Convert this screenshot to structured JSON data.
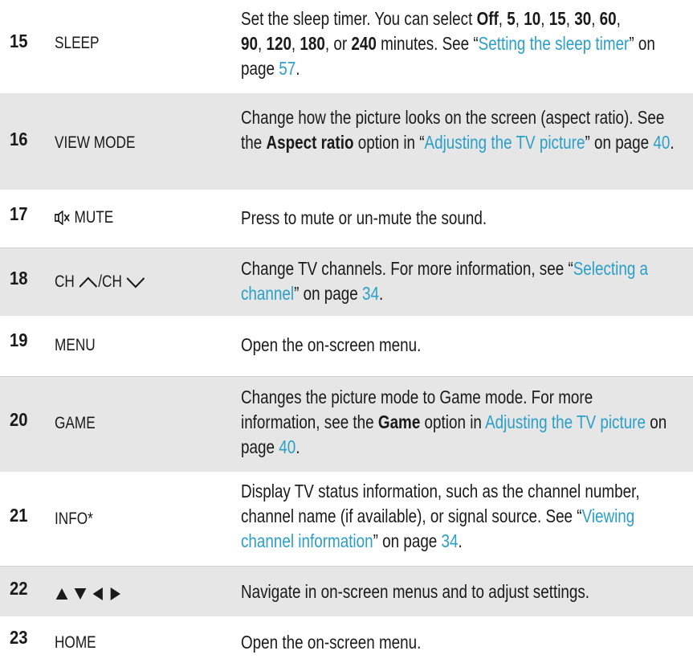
{
  "rows": [
    {
      "num": "15",
      "key": "SLEEP",
      "d": [
        "Set the sleep timer. You can select ",
        "Off",
        ", ",
        "5",
        ", ",
        "10",
        ", ",
        "15",
        ", ",
        "30",
        ", ",
        "60",
        ",",
        "90",
        ", ",
        "120",
        ", ",
        "180",
        ", or ",
        "240",
        " minutes. See “",
        "Setting the sleep timer",
        "” on page ",
        "57",
        "."
      ]
    },
    {
      "num": "16",
      "key": "VIEW MODE",
      "d": [
        "Change how the picture looks on the screen (aspect ratio). See the ",
        "Aspect ratio",
        " option in “",
        "Adjusting the TV picture",
        "” on page ",
        "40",
        "."
      ]
    },
    {
      "num": "17",
      "key": "MUTE",
      "d": [
        "Press to mute or un-mute the sound."
      ]
    },
    {
      "num": "18",
      "key_a": "CH ",
      "key_b": "/CH ",
      "d": [
        "Change TV channels. For more information, see “",
        "Selecting a channel",
        "” on page ",
        "34",
        "."
      ]
    },
    {
      "num": "19",
      "key": "MENU",
      "d": [
        "Open the on-screen menu."
      ]
    },
    {
      "num": "20",
      "key": "GAME",
      "d": [
        "Changes the picture mode to Game mode. For more information, see the ",
        "Game",
        " option in ",
        "Adjusting the TV picture",
        " on page  ",
        "40",
        "."
      ]
    },
    {
      "num": "21",
      "key": "INFO*",
      "d": [
        "Display TV status information, such as the channel number, channel name (if available), or signal source. See “",
        "Viewing channel information",
        "” on page ",
        "34",
        "."
      ]
    },
    {
      "num": "22",
      "d": [
        "Navigate in on-screen menus and to adjust settings."
      ]
    },
    {
      "num": "23",
      "key": "HOME",
      "d": [
        "Open the on-screen menu."
      ]
    }
  ],
  "colors": {
    "shade": "#e6e6e6",
    "link": "#2a9fc8",
    "text": "#1a1a1a"
  },
  "icons": {
    "mute": "speaker-mute-icon",
    "ch_up": "chevron-up-icon",
    "ch_down": "chevron-down-icon",
    "arrows": [
      "arrow-up-icon",
      "arrow-down-icon",
      "arrow-left-icon",
      "arrow-right-icon"
    ]
  }
}
